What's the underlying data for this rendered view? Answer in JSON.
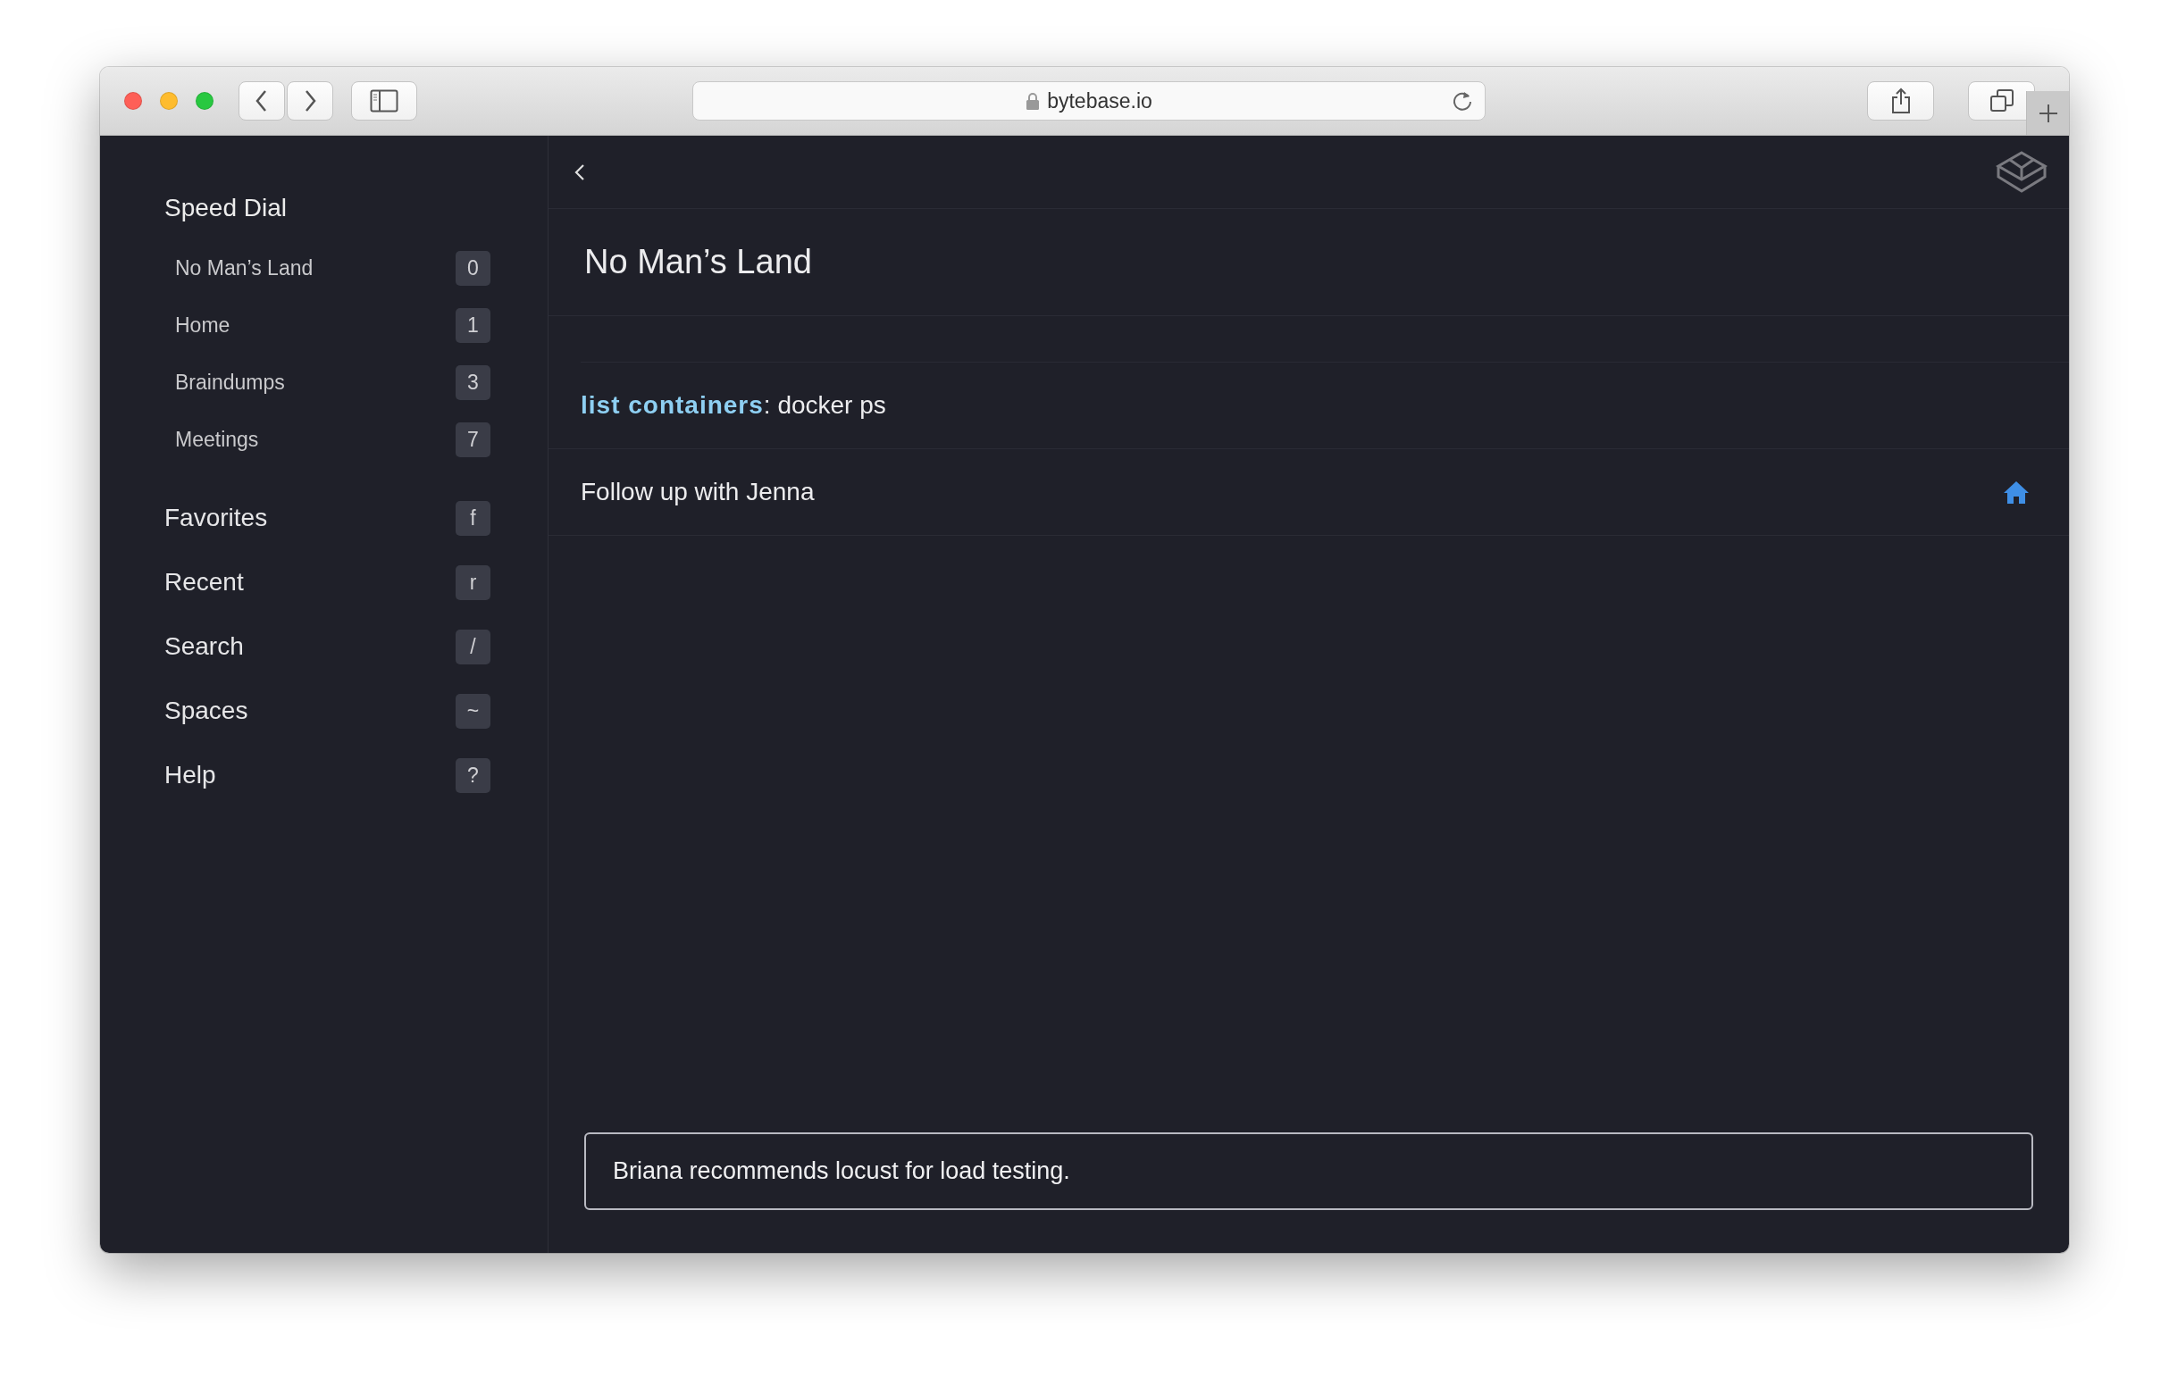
{
  "browser": {
    "url": "bytebase.io"
  },
  "sidebar": {
    "speed_dial": {
      "title": "Speed Dial",
      "items": [
        {
          "label": "No Man’s Land",
          "shortcut": "0"
        },
        {
          "label": "Home",
          "shortcut": "1"
        },
        {
          "label": "Braindumps",
          "shortcut": "3"
        },
        {
          "label": "Meetings",
          "shortcut": "7"
        }
      ]
    },
    "items": [
      {
        "label": "Favorites",
        "shortcut": "f"
      },
      {
        "label": "Recent",
        "shortcut": "r"
      },
      {
        "label": "Search",
        "shortcut": "/"
      },
      {
        "label": "Spaces",
        "shortcut": "~"
      },
      {
        "label": "Help",
        "shortcut": "?"
      }
    ]
  },
  "page": {
    "title": "No Man’s Land",
    "rows": [
      {
        "text": "**list containers**: docker ps",
        "in_home": false
      },
      {
        "text": "Follow up with Jenna",
        "in_home": true
      }
    ],
    "composer": {
      "value": "Briana recommends locust for load testing."
    }
  }
}
